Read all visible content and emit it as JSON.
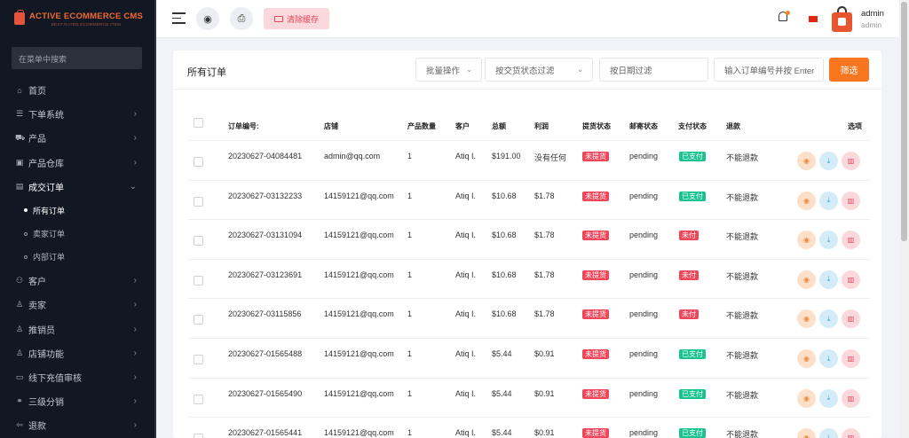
{
  "brand": {
    "name": "ACTIVE ECOMMERCE CMS",
    "sub": "BEST RATED ECOMMERCE ITEM"
  },
  "sidebar": {
    "search_placeholder": "在菜单中搜索",
    "items": [
      {
        "label": "首页",
        "icon": "⌂",
        "chevron": false
      },
      {
        "label": "下单系统",
        "icon": "☰",
        "chevron": true
      },
      {
        "label": "产品",
        "icon": "⛟",
        "chevron": true
      },
      {
        "label": "产品仓库",
        "icon": "▣",
        "chevron": true
      },
      {
        "label": "成交订单",
        "icon": "▤",
        "chevron": true,
        "open": true
      }
    ],
    "sub_items": [
      {
        "label": "所有订单",
        "active": true
      },
      {
        "label": "卖家订单",
        "active": false
      },
      {
        "label": "内部订单",
        "active": false
      }
    ],
    "items_after": [
      {
        "label": "客户",
        "icon": "⚇",
        "chevron": true
      },
      {
        "label": "卖家",
        "icon": "♙",
        "chevron": true
      },
      {
        "label": "推销员",
        "icon": "♙",
        "chevron": true
      },
      {
        "label": "店铺功能",
        "icon": "♙",
        "chevron": true
      },
      {
        "label": "线下充值审核",
        "icon": "▭",
        "chevron": true
      },
      {
        "label": "三级分销",
        "icon": "⚭",
        "chevron": true
      },
      {
        "label": "退款",
        "icon": "⇦",
        "chevron": true
      }
    ]
  },
  "topbar": {
    "clear_cache": "清除缓存",
    "user_name": "admin",
    "user_role": "admin"
  },
  "card": {
    "title": "所有订单",
    "bulk_action": "批量操作",
    "delivery_filter": "按交货状态过滤",
    "date_filter": "按日期过滤",
    "search_placeholder": "输入订单编号并按 Enter",
    "filter_button": "筛选"
  },
  "table": {
    "headers": [
      "订单编号:",
      "店铺",
      "产品数量",
      "客户",
      "总额",
      "利润",
      "提货状态",
      "邮寄状态",
      "支付状态",
      "退款",
      "选项"
    ],
    "rows": [
      {
        "order": "20230627-04084481",
        "shop": "admin@qq.com",
        "qty": "1",
        "customer": "Atiq I.",
        "total": "$191.00",
        "profit": "没有任何",
        "pickup": "未提货",
        "shipping": "pending",
        "payment": "已支付",
        "paid": true,
        "refund": "不能退款"
      },
      {
        "order": "20230627-03132233",
        "shop": "14159121@qq.com",
        "qty": "1",
        "customer": "Atiq I.",
        "total": "$10.68",
        "profit": "$1.78",
        "pickup": "未提货",
        "shipping": "pending",
        "payment": "已支付",
        "paid": true,
        "refund": "不能退款"
      },
      {
        "order": "20230627-03131094",
        "shop": "14159121@qq.com",
        "qty": "1",
        "customer": "Atiq I.",
        "total": "$10.68",
        "profit": "$1.78",
        "pickup": "未提货",
        "shipping": "pending",
        "payment": "未付",
        "paid": false,
        "refund": "不能退款"
      },
      {
        "order": "20230627-03123691",
        "shop": "14159121@qq.com",
        "qty": "1",
        "customer": "Atiq I.",
        "total": "$10.68",
        "profit": "$1.78",
        "pickup": "未提货",
        "shipping": "pending",
        "payment": "未付",
        "paid": false,
        "refund": "不能退款"
      },
      {
        "order": "20230627-03115856",
        "shop": "14159121@qq.com",
        "qty": "1",
        "customer": "Atiq I.",
        "total": "$10.68",
        "profit": "$1.78",
        "pickup": "未提货",
        "shipping": "pending",
        "payment": "未付",
        "paid": false,
        "refund": "不能退款"
      },
      {
        "order": "20230627-01565488",
        "shop": "14159121@qq.com",
        "qty": "1",
        "customer": "Atiq I.",
        "total": "$5.44",
        "profit": "$0.91",
        "pickup": "未提货",
        "shipping": "pending",
        "payment": "已支付",
        "paid": true,
        "refund": "不能退款"
      },
      {
        "order": "20230627-01565490",
        "shop": "14159121@qq.com",
        "qty": "1",
        "customer": "Atiq I.",
        "total": "$5.44",
        "profit": "$0.91",
        "pickup": "未提货",
        "shipping": "pending",
        "payment": "已支付",
        "paid": true,
        "refund": "不能退款"
      },
      {
        "order": "20230627-01565441",
        "shop": "14159121@qq.com",
        "qty": "1",
        "customer": "Atiq I.",
        "total": "$5.44",
        "profit": "$0.91",
        "pickup": "未提货",
        "shipping": "pending",
        "payment": "已支付",
        "paid": true,
        "refund": "不能退款"
      }
    ]
  },
  "colors": {
    "accent": "#f7761e",
    "sidebar_bg": "#111723",
    "badge_red": "#f0465a",
    "badge_green": "#18c38f"
  }
}
